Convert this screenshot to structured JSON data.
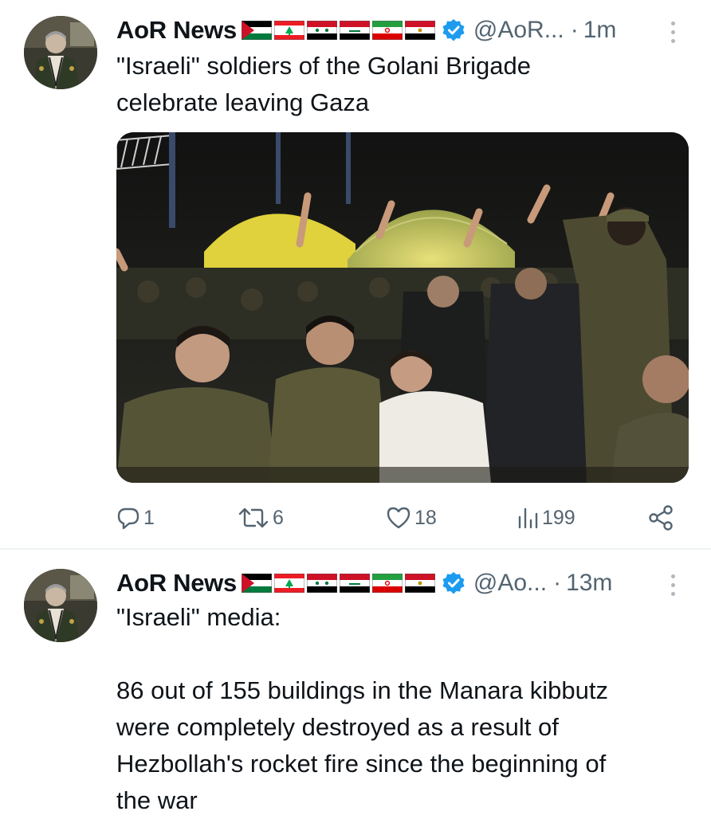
{
  "tweets": [
    {
      "display_name": "AoR News",
      "flags": [
        "palestine-flag",
        "lebanon-flag",
        "syria-flag",
        "iraq-flag",
        "iran-flag",
        "egypt-flag"
      ],
      "handle": "@AoR...",
      "separator": "·",
      "time": "1m",
      "text": "\"Israeli\" soldiers of the Golani Brigade\ncelebrate leaving Gaza",
      "media": {
        "kind": "photo",
        "caption_text": "",
        "icon": "photo-of-soldiers-celebrating"
      },
      "actions": {
        "replies": "1",
        "reposts": "6",
        "likes": "18",
        "views": "199"
      }
    },
    {
      "display_name": "AoR News",
      "flags": [
        "palestine-flag",
        "lebanon-flag",
        "syria-flag",
        "iraq-flag",
        "iran-flag",
        "egypt-flag"
      ],
      "handle": "@Ao...",
      "separator": "·",
      "time": "13m",
      "text": "\"Israeli\" media:\n\n86 out of 155 buildings in the Manara kibbutz\nwere completely destroyed as a result of\nHezbollah's rocket fire since the beginning of\nthe war"
    }
  ],
  "colors": {
    "text_primary": "#0f1419",
    "text_secondary": "#536471",
    "verified_blue": "#1d9bf0",
    "divider": "#eff3f4"
  },
  "icons": {
    "reply": "reply-icon",
    "repost": "repost-icon",
    "like": "like-icon",
    "views": "views-icon",
    "share": "share-icon",
    "more": "more-icon",
    "verified": "verified-badge-icon"
  }
}
